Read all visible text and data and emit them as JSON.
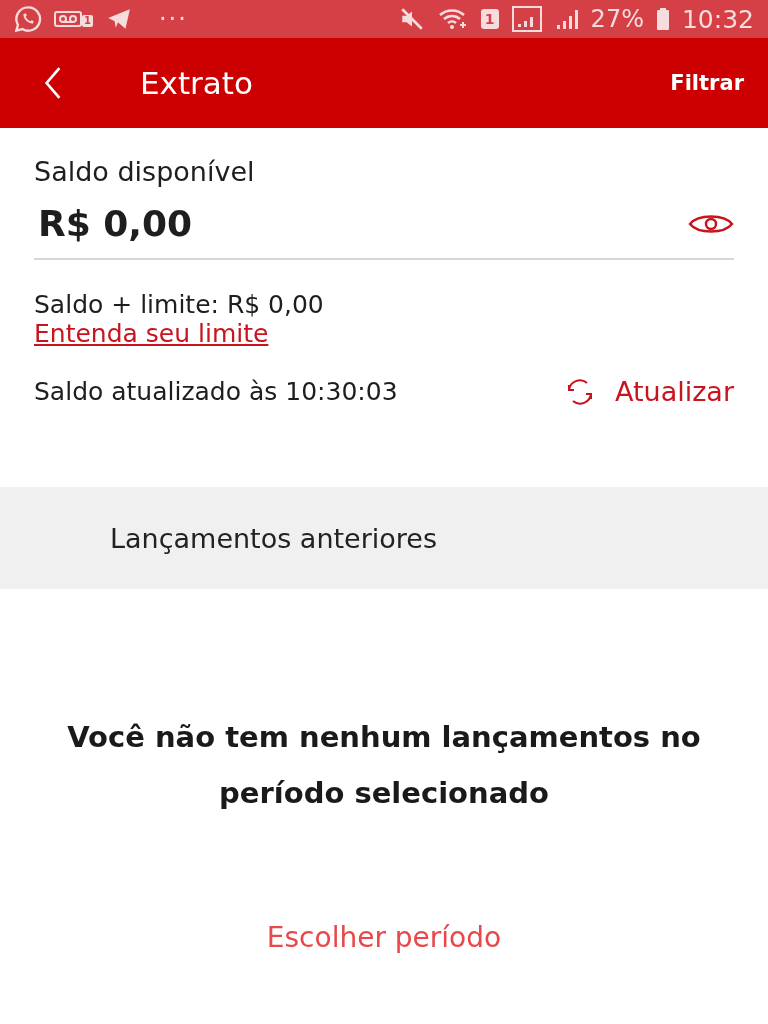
{
  "status_bar": {
    "voicemail_badge": "1",
    "sim_badge": "1",
    "battery": "27%",
    "time": "10:32",
    "dots": "···"
  },
  "app_bar": {
    "title": "Extrato",
    "action": "Filtrar"
  },
  "balance": {
    "label": "Saldo disponível",
    "value": "R$ 0,00",
    "hidden": false
  },
  "limit": {
    "text": "Saldo + limite: R$ 0,00",
    "link": "Entenda seu limite"
  },
  "update": {
    "text": "Saldo atualizado às 10:30:03",
    "action": "Atualizar"
  },
  "section": {
    "title": "Lançamentos anteriores"
  },
  "empty": {
    "message": "Você não tem nenhum lançamentos no período selecionado",
    "action": "Escolher período"
  }
}
